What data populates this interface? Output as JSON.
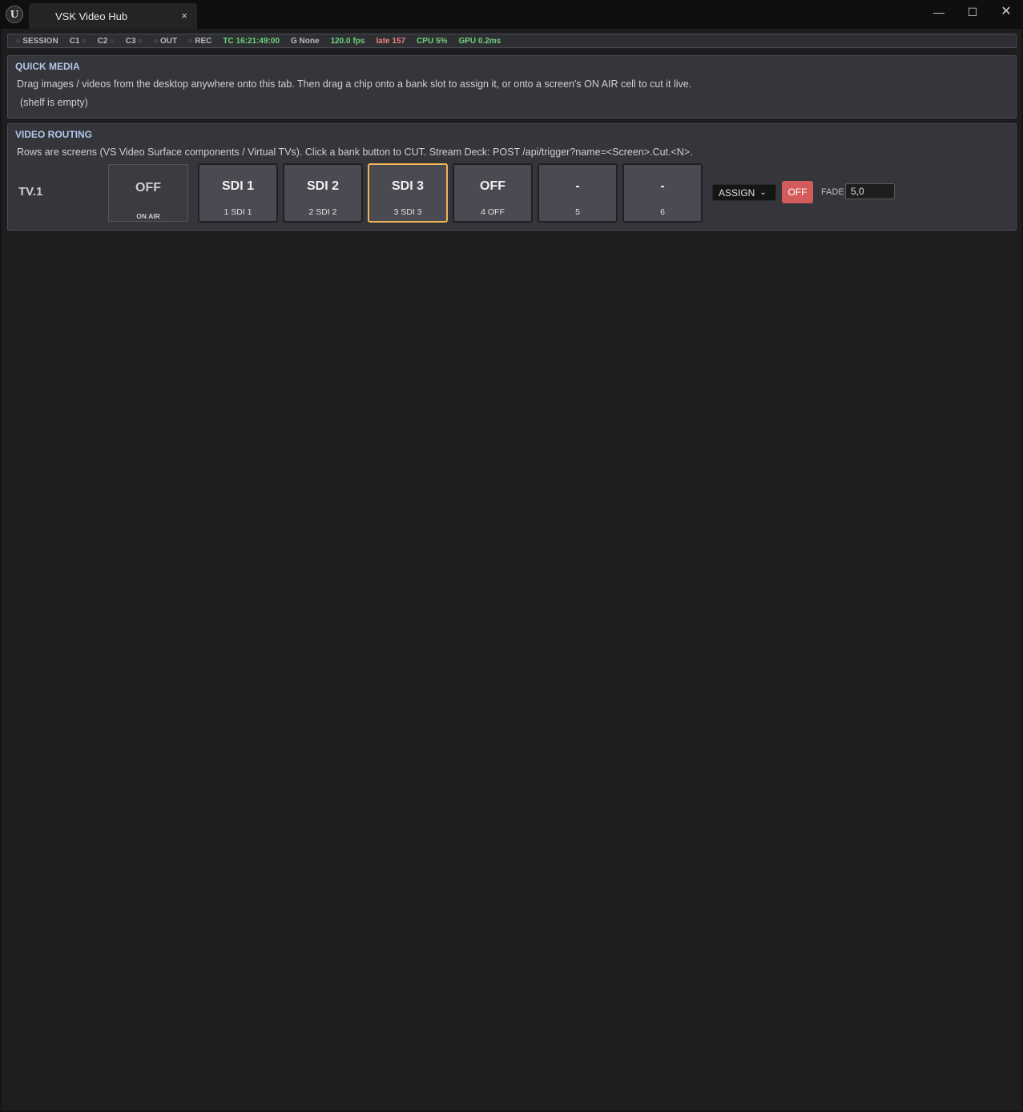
{
  "window": {
    "app_icon_glyph": "U",
    "tab_title": "VSK Video Hub",
    "tab_close": "×",
    "minimize": "—",
    "maximize": "☐",
    "close": "✕"
  },
  "status": {
    "session": "SESSION",
    "c1": "C1",
    "c2": "C2",
    "c3": "C3",
    "out": "OUT",
    "rec": "REC",
    "tc": "TC 16:21:49:00",
    "genlock": "G None",
    "fps": "120.0 fps",
    "late": "late 157",
    "cpu": "CPU 5%",
    "gpu": "GPU 0.2ms",
    "dot": "○",
    "colors": {
      "ok": "#6fd17a",
      "warn": "#f07f7f"
    }
  },
  "quick_media": {
    "title": "QUICK MEDIA",
    "help": "Drag images / videos from the desktop anywhere onto this tab. Then drag a chip onto a bank slot to assign it, or onto a screen's ON AIR cell to cut it live.",
    "empty": "(shelf is empty)"
  },
  "routing": {
    "title": "VIDEO ROUTING",
    "help": "Rows are screens (VS Video Surface components / Virtual TVs). Click a bank button to CUT. Stream Deck: POST /api/trigger?name=<Screen>.Cut.<N>.",
    "rows": [
      {
        "name": "TV.1",
        "on_air_value": "OFF",
        "on_air_caption": "ON AIR",
        "banks": [
          {
            "main": "SDI 1",
            "sub": "1  SDI 1",
            "active": false
          },
          {
            "main": "SDI 2",
            "sub": "2  SDI 2",
            "active": false
          },
          {
            "main": "SDI 3",
            "sub": "3  SDI 3",
            "active": true
          },
          {
            "main": "OFF",
            "sub": "4  OFF",
            "active": false
          },
          {
            "main": "-",
            "sub": "5",
            "active": false
          },
          {
            "main": "-",
            "sub": "6",
            "active": false
          }
        ],
        "assign_label": "ASSIGN",
        "assign_chevron": "⌄",
        "off_label": "OFF",
        "fade_label": "FADE",
        "fade_value": "5,0"
      }
    ],
    "colors": {
      "active_border": "#f1b552",
      "off_button": "#d35b5b"
    }
  }
}
